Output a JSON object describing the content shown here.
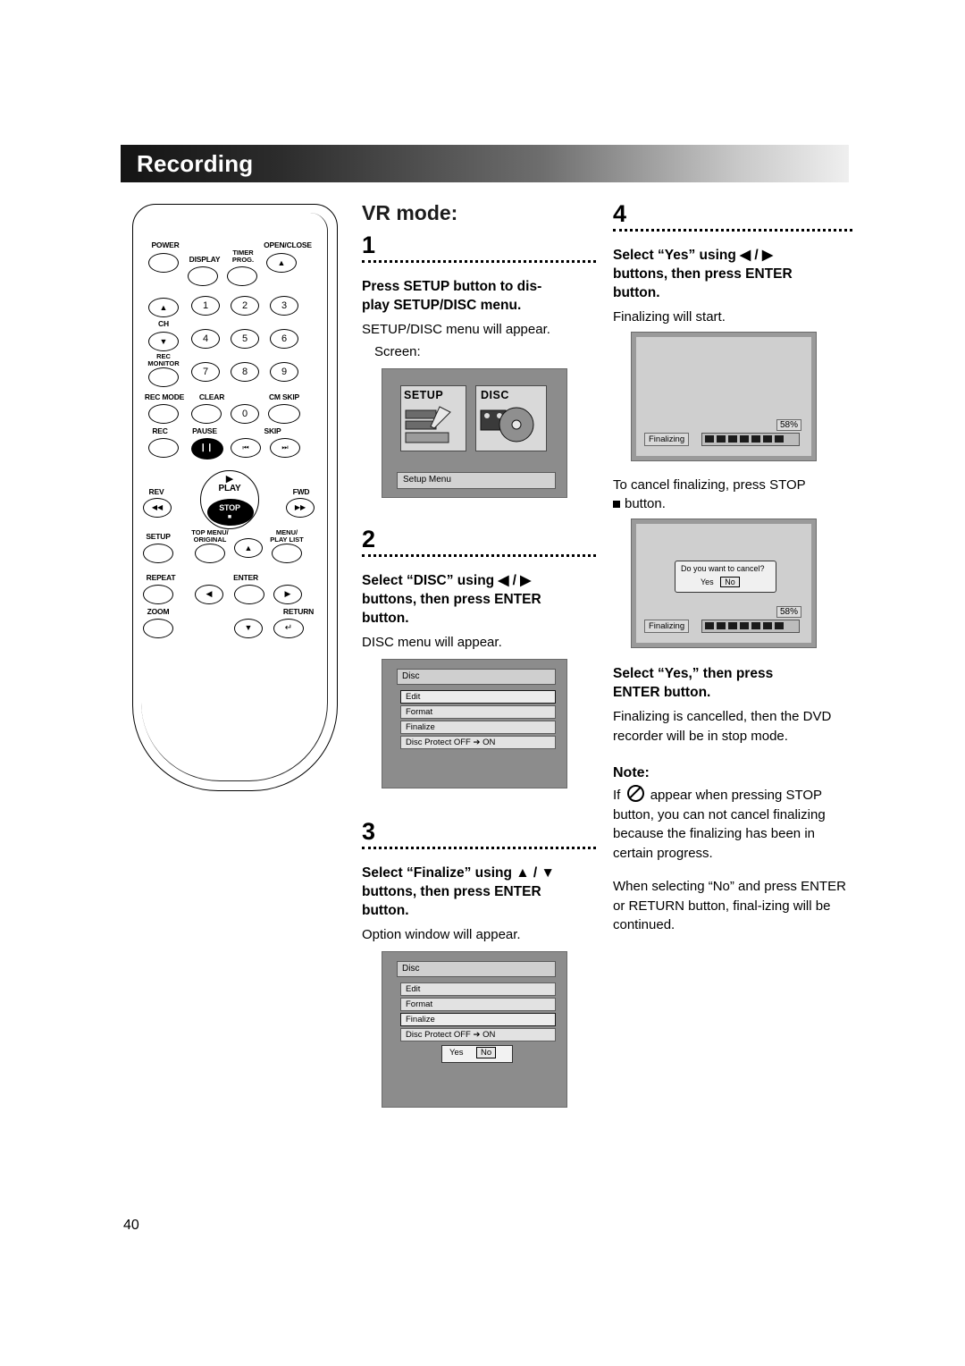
{
  "header": {
    "title": "Recording"
  },
  "page_number": "40",
  "remote": {
    "labels": {
      "power": "POWER",
      "display": "DISPLAY",
      "timer_prog": "TIMER\nPROG.",
      "open_close": "OPEN/CLOSE",
      "ch": "CH",
      "rec_monitor": "REC\nMONITOR",
      "rec_mode": "REC MODE",
      "clear": "CLEAR",
      "cm_skip": "CM SKIP",
      "rec": "REC",
      "pause": "PAUSE",
      "skip": "SKIP",
      "rev": "REV",
      "play": "PLAY",
      "fwd": "FWD",
      "stop": "STOP",
      "setup": "SETUP",
      "top_menu_original": "TOP MENU/\nORIGINAL",
      "menu_play_list": "MENU/\nPLAY LIST",
      "repeat": "REPEAT",
      "enter": "ENTER",
      "zoom": "ZOOM",
      "return": "RETURN"
    },
    "numbers": [
      "1",
      "2",
      "3",
      "4",
      "5",
      "6",
      "7",
      "8",
      "9",
      "0"
    ]
  },
  "middle": {
    "vr_mode_title": "VR mode:",
    "steps": [
      {
        "number": "1",
        "heading": "Press SETUP button to dis-play SETUP/DISC menu.",
        "heading_line1": "Press SETUP button to dis-",
        "heading_line2": "play SETUP/DISC menu.",
        "body1": "SETUP/DISC menu will appear.",
        "body2": "Screen:"
      },
      {
        "number": "2",
        "heading_line1": "Select “DISC” using ◀ / ▶",
        "heading_line2": "buttons, then press ENTER",
        "heading_line3": "button.",
        "body1": "DISC menu will appear."
      },
      {
        "number": "3",
        "heading_line1": "Select “Finalize” using ▲ / ▼",
        "heading_line2": "buttons, then press ENTER",
        "heading_line3": "button.",
        "body1": "Option window will appear."
      }
    ],
    "screen_setupdisc": {
      "setup_label": "SETUP",
      "disc_label": "DISC",
      "setup_menu": "Setup Menu"
    },
    "screen_disc_2": {
      "title": "Disc",
      "rows": [
        "Edit",
        "Format",
        "Finalize",
        "Disc Protect OFF ➔ ON"
      ],
      "selected_row": 0
    },
    "screen_disc_3": {
      "title": "Disc",
      "rows": [
        "Edit",
        "Format",
        "Finalize",
        "Disc Protect OFF ➔ ON"
      ],
      "selected_row": 2,
      "yes_label": "Yes",
      "no_label": "No"
    }
  },
  "right": {
    "step": {
      "number": "4",
      "heading_line1": "Select “Yes” using ◀ / ▶",
      "heading_line2": "buttons, then press ENTER",
      "heading_line3": "button.",
      "body1": "Finalizing will start."
    },
    "screen_finalizing": {
      "label": "Finalizing",
      "percent": "58%"
    },
    "cancel_text_line1": "To cancel finalizing, press STOP",
    "cancel_text_line2": "button.",
    "screen_cancel": {
      "question": "Do you want to cancel?",
      "yes_label": "Yes",
      "no_label": "No",
      "label": "Finalizing",
      "percent": "58%"
    },
    "step2_head_line1": "Select “Yes,” then press",
    "step2_head_line2": "ENTER button.",
    "step2_body": "Finalizing is cancelled, then the DVD recorder will be in stop mode.",
    "note_title": "Note:",
    "note_para1_pre": "If",
    "note_para1_post": "appear when pressing STOP button, you can not cancel finalizing because the finalizing has been in certain progress.",
    "note_para2": "When selecting “No” and press ENTER or RETURN button, final-izing will be continued."
  }
}
